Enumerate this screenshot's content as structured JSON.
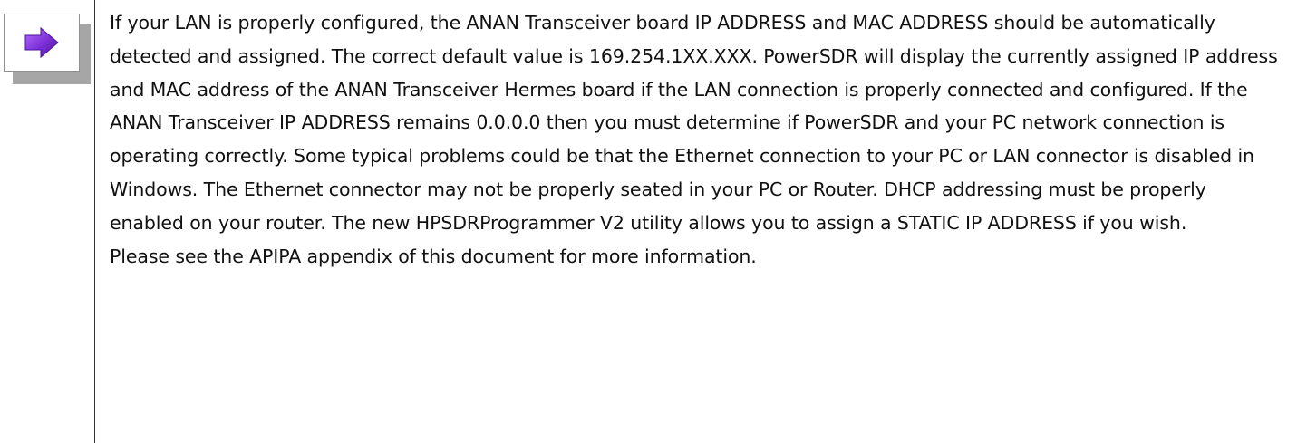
{
  "note": {
    "icon": "right-arrow-icon",
    "colors": {
      "arrow": "#7b2fd6",
      "shadow": "#a6a6a6",
      "divider": "#333333"
    },
    "paragraph_1": "If your LAN is properly configured, the ANAN Transceiver board IP ADDRESS and MAC ADDRESS should be automatically detected and assigned. The correct default value is 169.254.1XX.XXX. PowerSDR will display the currently assigned IP address and MAC address of the ANAN Transceiver Hermes board if the LAN connection is properly connected and configured. If the ANAN Transceiver IP ADDRESS remains 0.0.0.0 then you must determine if PowerSDR and your PC network connection is operating correctly. Some typical problems could be that the Ethernet connection to your PC or LAN connector is disabled in Windows. The Ethernet connector may not be properly seated in your PC or Router. DHCP addressing must be properly enabled on your router. The new HPSDRProgrammer V2 utility allows you to assign a STATIC IP ADDRESS if you wish.",
    "paragraph_2": "Please see the APIPA appendix of this document for more information."
  }
}
